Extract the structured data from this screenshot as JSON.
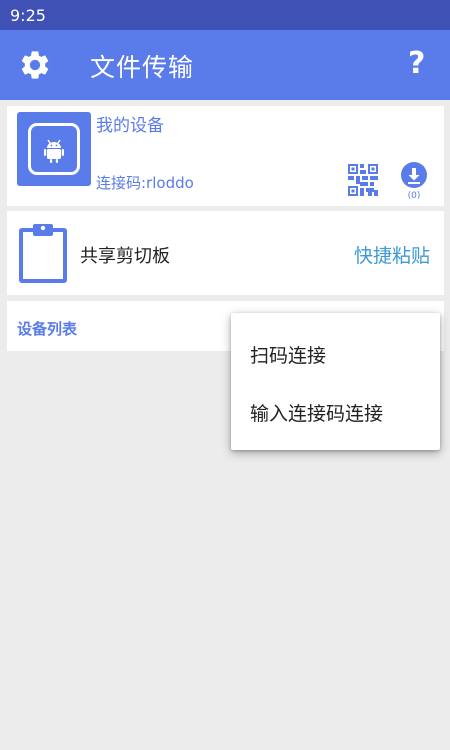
{
  "status_bar": {
    "time": "9:25"
  },
  "app_bar": {
    "title": "文件传输",
    "help_label": "?"
  },
  "device": {
    "name": "我的设备",
    "connection_code_label": "连接码:rloddo",
    "download_count": "(0)"
  },
  "clipboard": {
    "label": "共享剪切板",
    "paste_label": "快捷粘贴"
  },
  "device_list": {
    "title": "设备列表"
  },
  "popup_menu": {
    "items": [
      "扫码连接",
      "输入连接码连接"
    ]
  },
  "colors": {
    "status_bar": "#3f51b5",
    "app_bar": "#5a7bea",
    "accent_text": "#5a7bea",
    "paste_link": "#3c9ad8",
    "background": "#ececec"
  },
  "icons": [
    "gear-icon",
    "help-icon",
    "android-icon",
    "qr-code-icon",
    "download-icon",
    "clipboard-icon"
  ]
}
